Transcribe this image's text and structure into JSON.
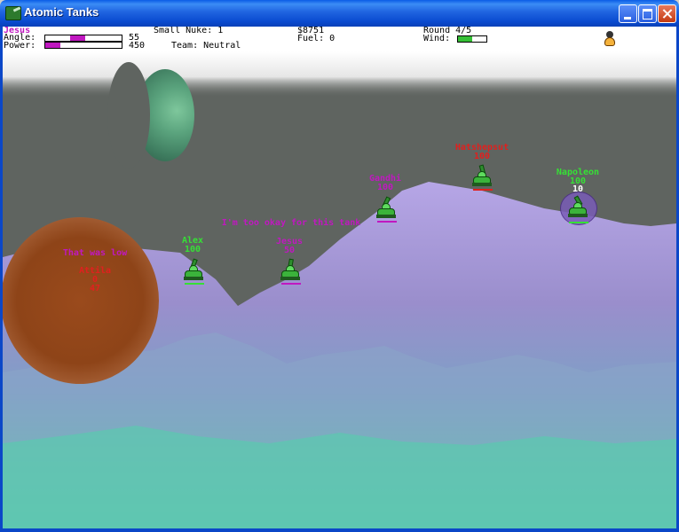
{
  "window": {
    "title": "Atomic Tanks"
  },
  "hud": {
    "player_name": "Jesus",
    "angle_label": "Angle:",
    "angle_value": "55",
    "angle_fraction": 0.2,
    "power_label": "Power:",
    "power_value": "450",
    "power_fraction": 0.2,
    "weapon": "Small Nuke: 1",
    "team": "Team: Neutral",
    "money": "$8751",
    "fuel": "Fuel: 0",
    "round": "Round 4/5",
    "wind_label": "Wind:",
    "wind_fraction": 0.5
  },
  "colors": {
    "player_magenta": "#c018c0",
    "tank_green": "#3bb33b",
    "enemy_red": "#e0201e",
    "purple_text": "#b030c0",
    "sky": "#5f6460",
    "terrain_purple": "#a696d6",
    "terrain_teal": "#58c8a8"
  },
  "tanks": [
    {
      "name": "Alex",
      "health": "100",
      "color": "#36e036"
    },
    {
      "name": "Jesus",
      "health": "50",
      "color": "#c018c0"
    },
    {
      "name": "Gandhi",
      "health": "100",
      "color": "#c018c0"
    },
    {
      "name": "Hatshepsut",
      "health": "100",
      "color": "#e0201e"
    },
    {
      "name": "Napoleon",
      "health": "100",
      "damage": "10",
      "color": "#36e036"
    },
    {
      "name": "Attila",
      "health": "0",
      "damage": "47",
      "color": "#e0201e"
    }
  ],
  "chat": [
    {
      "text": "I'm too okay for this tank"
    },
    {
      "text": "That was low"
    }
  ]
}
